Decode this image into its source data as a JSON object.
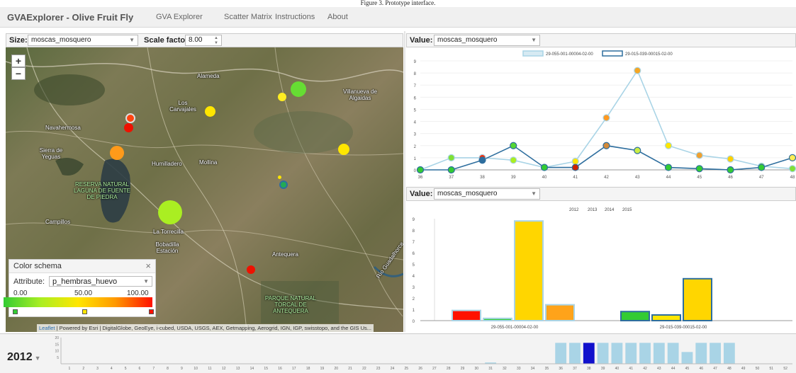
{
  "caption": "Figure 3. Prototype interface.",
  "nav": {
    "brand": "GVAExplorer - Olive Fruit Fly",
    "links": [
      "GVA Explorer",
      "Scatter Matrix",
      "Instructions",
      "About"
    ]
  },
  "left_toolbar": {
    "size_label": "Size:",
    "size_value": "moscas_mosquero",
    "scale_label": "Scale factor:",
    "scale_value": "8.00"
  },
  "map": {
    "zoom_in": "+",
    "zoom_out": "−",
    "places": [
      "Alameda",
      "Los Carvajales",
      "Villanueva de Algaidas",
      "Navahermosa",
      "Sierra de Yeguas",
      "Humilladero",
      "Mollina",
      "RESERVA NATURAL LAGUNA DE FUENTE DE PIEDRA",
      "Campillos",
      "La Torrecilla",
      "Bobadilla Estación",
      "Antequera",
      "PARQUE NATURAL TORCAL DE ANTEQUERA",
      "Río Guadalhorce"
    ],
    "attribution_link": "Leaflet",
    "attribution": " | Powered by Esri | DigitalGlobe, GeoEye, i-cubed, USDA, USGS, AEX, Getmapping, Aerogrid, IGN, IGP, swisstopo, and the GIS Us..."
  },
  "color_schema": {
    "title": "Color schema",
    "close": "×",
    "attribute_label": "Attribute:",
    "attribute_value": "p_hembras_huevo",
    "min": "0.00",
    "mid": "50.00",
    "max": "100.00",
    "colors": {
      "low": "#33cc33",
      "mid": "#ffe600",
      "high": "#ff1100"
    }
  },
  "line_panel": {
    "value_label": "Value:",
    "value_selected": "moscas_mosquero"
  },
  "bar_panel": {
    "value_label": "Value:",
    "value_selected": "moscas_mosquero"
  },
  "timeline": {
    "year": "2012",
    "selected_week": "38"
  },
  "chart_data": [
    {
      "type": "line",
      "legend": [
        "29-055-001-00004-02-00",
        "29-015-039-00015-02-00"
      ],
      "x": [
        36,
        37,
        38,
        39,
        40,
        41,
        42,
        43,
        44,
        45,
        46,
        47,
        48
      ],
      "ylim": [
        0,
        9
      ],
      "yticks": [
        0,
        1,
        2,
        3,
        4,
        5,
        6,
        7,
        8,
        9
      ],
      "series": [
        {
          "name": "29-055-001-00004-02-00",
          "color": "#a9d4e6",
          "values": [
            0,
            1,
            1,
            0.8,
            0.2,
            0.7,
            4.3,
            8.2,
            2,
            1.2,
            0.9,
            0.3,
            0.1
          ]
        },
        {
          "name": "29-015-039-00015-02-00",
          "color": "#2e6e9e",
          "values": [
            0,
            0,
            0.8,
            2,
            0.2,
            0.2,
            2,
            1.6,
            0.2,
            0.1,
            0,
            0.2,
            1
          ]
        }
      ],
      "point_colors": {
        "s1": [
          "#7fe035",
          "#7fe035",
          "#ff2a00",
          "#aaee22",
          "#7fe035",
          "#ffe600",
          "#ff9922",
          "#f5a623",
          "#ffe600",
          "#f0a030",
          "#ffd000",
          "#7fe035",
          "#7fe035"
        ],
        "s2": [
          "#33cc33",
          "#33cc33",
          "#2e6e9e",
          "#55d633",
          "#33cc33",
          "#cc2200",
          "#d38a3a",
          "#ccee44",
          "#33cc33",
          "#33cc33",
          "#33cc33",
          "#33cc33",
          "#ffee55"
        ]
      }
    },
    {
      "type": "bar",
      "legend": [
        "2012",
        "2013",
        "2014",
        "2015"
      ],
      "categories": [
        "29-055-001-00004-02-00",
        "29-015-039-00015-02-00"
      ],
      "ylim": [
        0,
        9
      ],
      "yticks": [
        0,
        1,
        2,
        3,
        4,
        5,
        6,
        7,
        8,
        9
      ],
      "series": [
        {
          "name": "2012",
          "values": [
            0.9,
            0.8
          ],
          "fill": [
            "#ff1100",
            "#33cc33"
          ],
          "stroke": [
            "#a9d4e6",
            "#2e6e9e"
          ]
        },
        {
          "name": "2013",
          "values": [
            0.2,
            0.5
          ],
          "fill": [
            "#33cc33",
            "#ffe600"
          ],
          "stroke": [
            "#a9d4e6",
            "#2e6e9e"
          ]
        },
        {
          "name": "2014",
          "values": [
            8.8,
            3.7
          ],
          "fill": [
            "#ffd600",
            "#ffd600"
          ],
          "stroke": [
            "#a9d4e6",
            "#2e6e9e"
          ]
        },
        {
          "name": "2015",
          "values": [
            1.4,
            0
          ],
          "fill": [
            "#ffa31a",
            "#ffa31a"
          ],
          "stroke": [
            "#a9d4e6",
            "#2e6e9e"
          ]
        }
      ]
    },
    {
      "type": "bar",
      "x": [
        1,
        2,
        3,
        4,
        5,
        6,
        7,
        8,
        9,
        10,
        11,
        12,
        13,
        14,
        15,
        16,
        17,
        18,
        19,
        20,
        21,
        22,
        23,
        24,
        25,
        26,
        27,
        28,
        29,
        30,
        31,
        32,
        33,
        34,
        35,
        36,
        37,
        38,
        39,
        40,
        41,
        42,
        43,
        44,
        45,
        46,
        47,
        48,
        49,
        50,
        51,
        52
      ],
      "values": [
        0,
        0,
        0,
        0,
        0,
        0,
        0,
        0,
        0,
        0,
        0,
        0,
        0,
        0,
        0,
        0,
        0,
        0,
        0,
        0,
        0,
        0,
        0,
        0,
        0,
        0,
        0,
        0,
        0,
        0,
        1,
        0,
        0,
        0,
        0,
        16,
        16,
        16,
        16,
        16,
        16,
        16,
        16,
        16,
        9,
        16,
        16,
        16,
        0,
        0,
        0,
        0
      ],
      "yticks": [
        5,
        10,
        15,
        20
      ],
      "ylim": [
        0,
        20
      ],
      "selected": 38,
      "colors": {
        "bar": "#a9d4e6",
        "selected": "#1111cc"
      }
    }
  ]
}
